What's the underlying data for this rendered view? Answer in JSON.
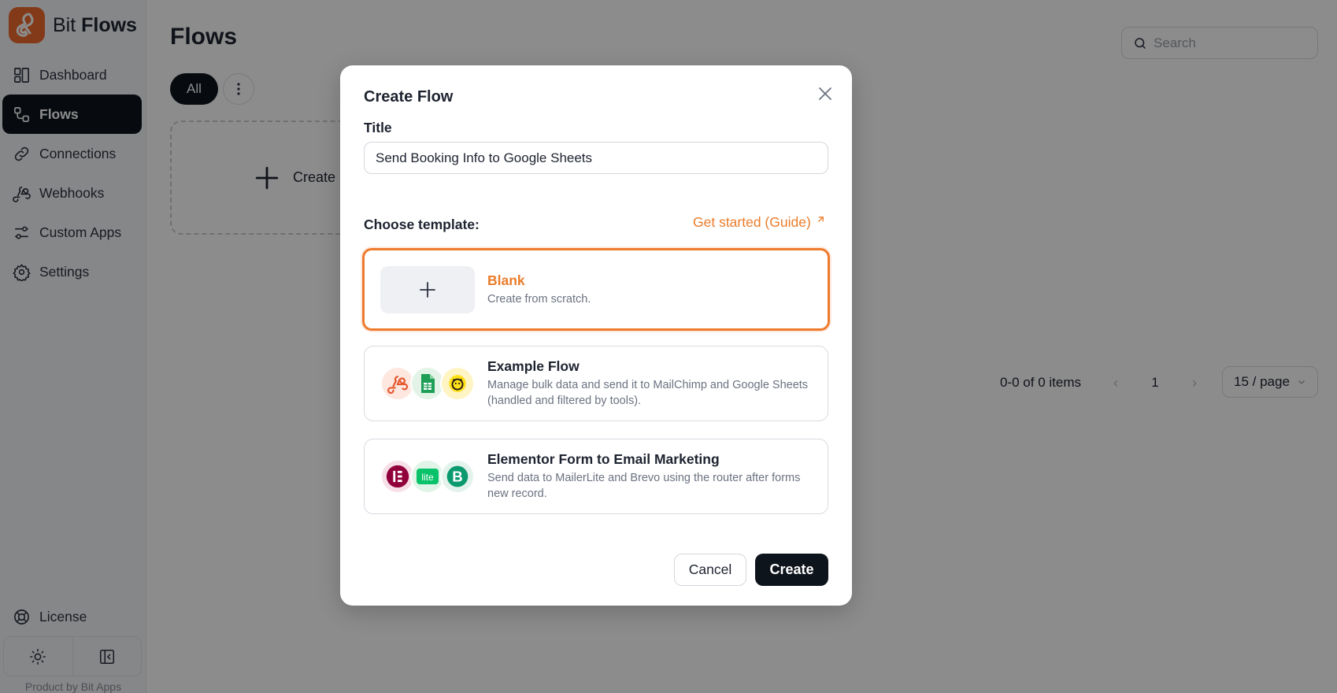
{
  "app": {
    "brand_light": "Bit ",
    "brand_bold": "Flows"
  },
  "sidebar": {
    "items": [
      {
        "label": "Dashboard",
        "icon": "dashboard-icon"
      },
      {
        "label": "Flows",
        "icon": "flows-icon",
        "active": true
      },
      {
        "label": "Connections",
        "icon": "link-icon"
      },
      {
        "label": "Webhooks",
        "icon": "webhook-icon"
      },
      {
        "label": "Custom Apps",
        "icon": "sliders-icon"
      },
      {
        "label": "Settings",
        "icon": "gear-icon"
      }
    ],
    "license_label": "License",
    "product_by": "Product by Bit Apps"
  },
  "main": {
    "title": "Flows",
    "search_placeholder": "Search",
    "filter_all": "All",
    "create_card_label": "Create F",
    "pagination": {
      "summary": "0-0 of 0 items",
      "current_page": "1",
      "page_size": "15 / page"
    }
  },
  "modal": {
    "title": "Create Flow",
    "title_label": "Title",
    "title_value": "Send Booking Info to Google Sheets",
    "choose_label": "Choose template:",
    "guide_link": "Get started (Guide)",
    "templates": [
      {
        "name": "Blank",
        "desc": "Create from scratch.",
        "selected": true
      },
      {
        "name": "Example Flow",
        "desc": "Manage bulk data and send it to MailChimp and Google Sheets (handled and filtered by tools)."
      },
      {
        "name": "Elementor Form to Email Marketing",
        "desc": "Send data to MailerLite and Brevo using the router after forms new record."
      }
    ],
    "cancel_label": "Cancel",
    "create_label": "Create"
  },
  "colors": {
    "accent": "#ee7a2e",
    "dark": "#0e141c",
    "overlay": "rgba(0,0,0,0.45)"
  }
}
